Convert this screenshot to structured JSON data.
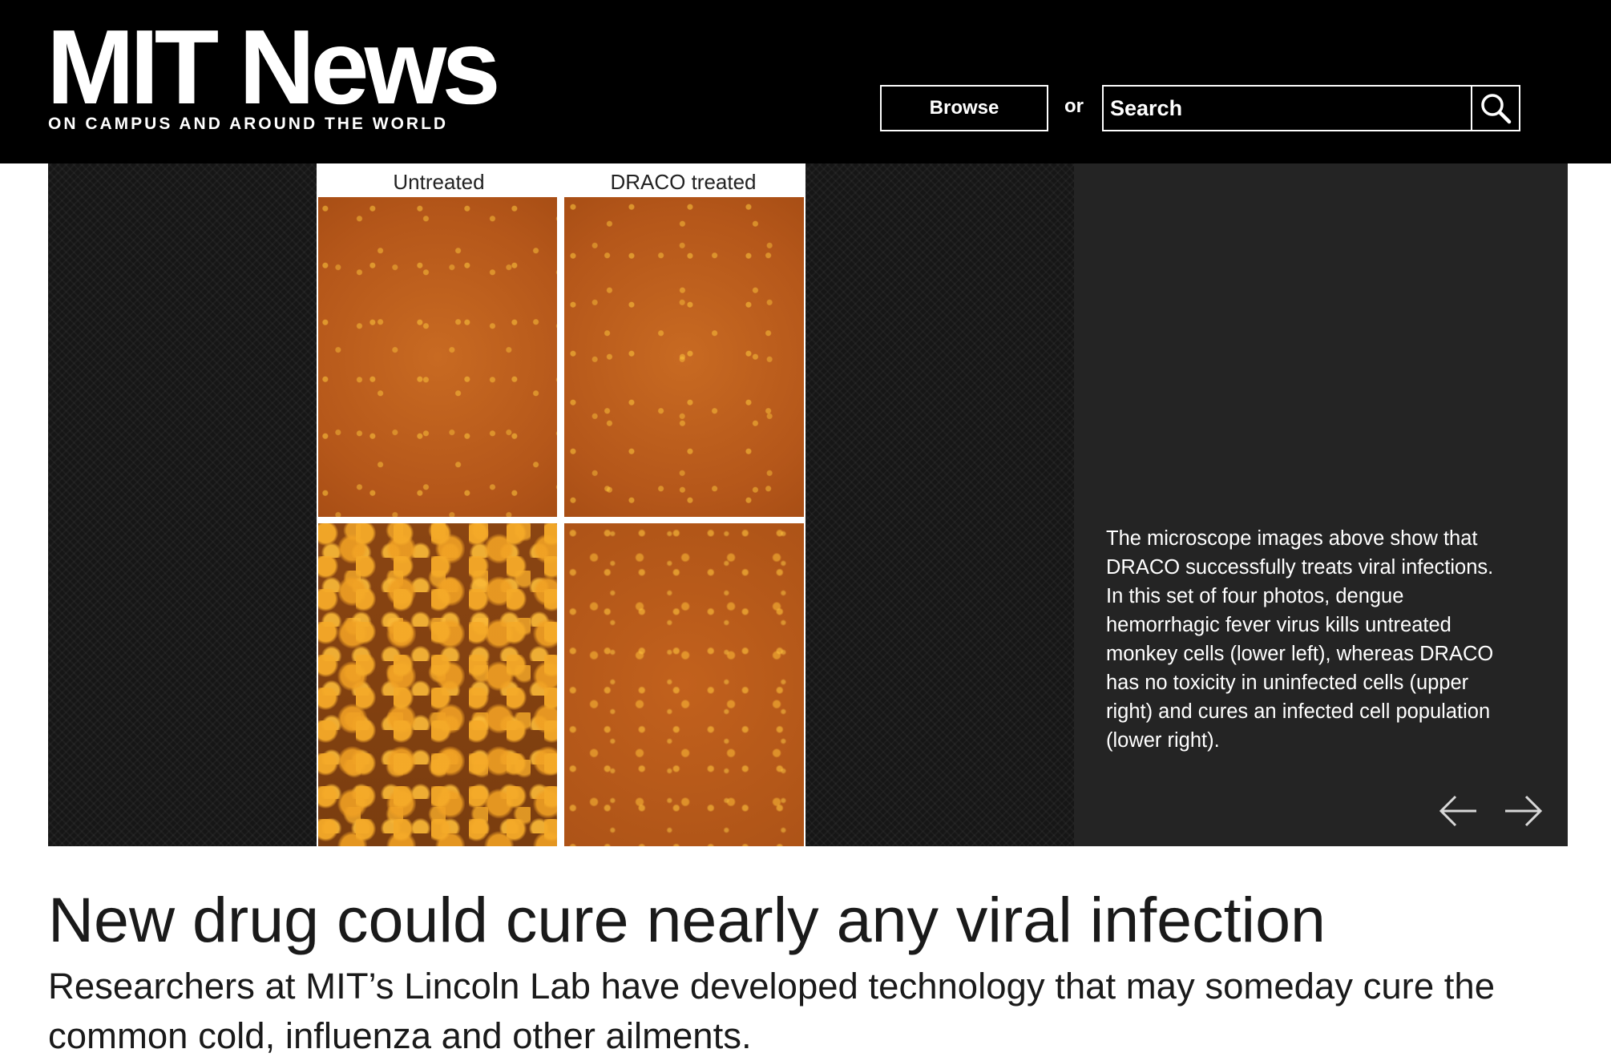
{
  "header": {
    "logo": "MIT News",
    "tagline": "ON CAMPUS AND AROUND THE WORLD",
    "browse_label": "Browse",
    "or_text": "or",
    "search_placeholder": "Search",
    "search_icon": "magnifier-icon"
  },
  "slideshow": {
    "figure_labels": {
      "left": "Untreated",
      "right": "DRACO treated"
    },
    "caption": "The microscope images above show that DRACO successfully treats viral infections. In this set of four photos, dengue hemorrhagic fever virus kills untreated monkey cells (lower left), whereas DRACO has no toxicity in uninfected cells (upper right) and cures an infected cell population (lower right).",
    "prev_icon": "arrow-left-icon",
    "next_icon": "arrow-right-icon"
  },
  "article": {
    "headline": "New drug could cure nearly any viral infection",
    "dek": "Researchers at MIT’s Lincoln Lab have developed technology that may someday cure the common cold, influenza and other ailments."
  },
  "colors": {
    "header_bg": "#000000",
    "caption_bg": "#242424",
    "text": "#1a1a1a"
  }
}
